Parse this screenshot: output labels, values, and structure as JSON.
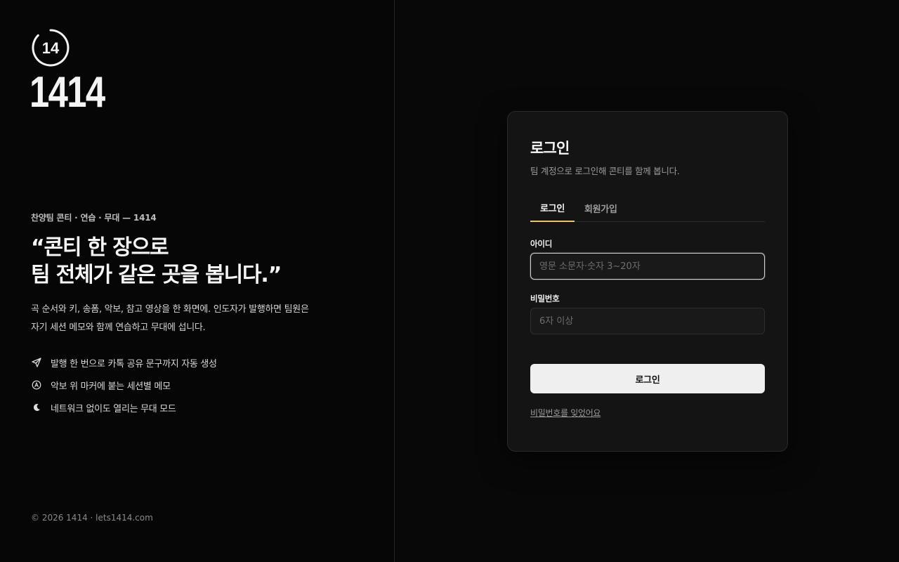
{
  "brand": {
    "mark_text": "14",
    "wordmark": "1414"
  },
  "intro": {
    "eyebrow": "찬양팀 콘티 · 연습 · 무대 — 1414",
    "headline_line1": "“콘티 한 장으로",
    "headline_line2": "팀 전체가 같은 곳을 봅니다.”",
    "lede_line1": "곡 순서와 키, 송폼, 악보, 참고 영상을 한 화면에. 인도자가 발행하면 팀원은",
    "lede_line2": "자기 세션 메모와 함께 연습하고 무대에 섭니다.",
    "features": [
      {
        "icon": "send-icon",
        "text": "발행 한 번으로 카톡 공유 문구까지 자동 생성"
      },
      {
        "icon": "circled-a-icon",
        "text": "악보 위 마커에 붙는 세션별 메모"
      },
      {
        "icon": "moon-icon",
        "text": "네트워크 없이도 열리는 무대 모드"
      }
    ]
  },
  "footer": {
    "text": "© 2026 1414 · lets1414.com"
  },
  "login_card": {
    "title": "로그인",
    "subtitle": "팀 계정으로 로그인해 콘티를 함께 봅니다.",
    "tabs": [
      {
        "label": "로그인",
        "active": true
      },
      {
        "label": "회원가입",
        "active": false
      }
    ],
    "id_label": "아이디",
    "id_value": "",
    "id_placeholder": "영문 소문자·숫자 3~20자",
    "password_label": "비밀번호",
    "password_value": "",
    "password_placeholder": "6자 이상",
    "submit_label": "로그인",
    "forgot_label": "비밀번호를 잊었어요"
  },
  "colors": {
    "accent_tab_underline": "#e9c46a",
    "background": "#080808",
    "card_background": "#141414",
    "button_background": "#efefef"
  }
}
